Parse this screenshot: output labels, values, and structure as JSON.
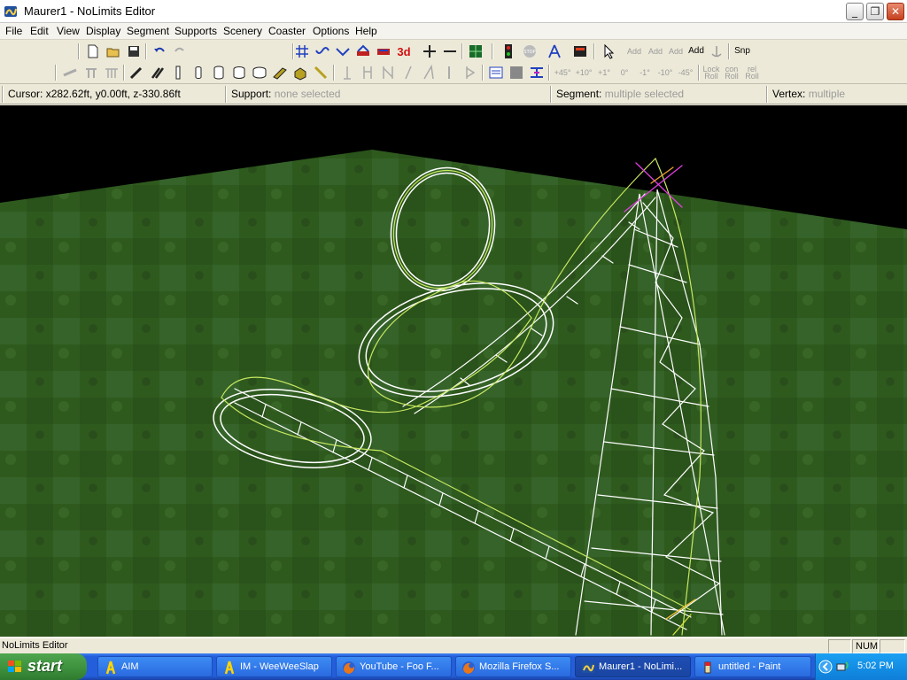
{
  "window": {
    "title": "Maurer1 - NoLimits Editor",
    "icon": "nolimits-app-icon",
    "controls": {
      "minimize": "_",
      "restore": "❐",
      "close": "✕"
    }
  },
  "menu": [
    "File",
    "Edit",
    "View",
    "Display",
    "Segment",
    "Supports",
    "Scenery",
    "Coaster",
    "Options",
    "Help"
  ],
  "toolbar": {
    "snap_label": "Snp",
    "add_labels": [
      "Add",
      "Add",
      "Add",
      "Add"
    ],
    "roll_labels": [
      "+45°",
      "+10°",
      "+1°",
      "0°",
      "-1°",
      "-10°",
      "-45°"
    ],
    "lock_roll": "Lock Roll",
    "con_roll": "con Roll",
    "rel_roll": "rel Roll",
    "view3d": "3d"
  },
  "infobar": {
    "cursor_label": "Cursor:",
    "cursor_value": "x282.62ft, y0.00ft, z-330.86ft",
    "support_label": "Support:",
    "support_value": "none selected",
    "segment_label": "Segment:",
    "segment_value": "multiple selected",
    "vertex_label": "Vertex:",
    "vertex_value": "multiple"
  },
  "colors": {
    "ground": "#2f5a1e",
    "sky": "#000000",
    "track_rail": "#ffffff",
    "spine": "#c8e860",
    "handle": "#e040e0",
    "handle_alt": "#f0a030"
  },
  "statusbar": {
    "text": "NoLimits Editor",
    "num": "NUM"
  },
  "taskbar": {
    "start": "start",
    "tasks": [
      {
        "label": "AIM",
        "icon": "aim-icon",
        "active": false
      },
      {
        "label": "IM - WeeWeeSlap",
        "icon": "aim-icon",
        "active": false
      },
      {
        "label": "YouTube - Foo F...",
        "icon": "firefox-icon",
        "active": false
      },
      {
        "label": "Mozilla Firefox S...",
        "icon": "firefox-icon",
        "active": false
      },
      {
        "label": "Maurer1 - NoLimi...",
        "icon": "nolimits-app-icon",
        "active": true
      },
      {
        "label": "untitled - Paint",
        "icon": "paint-icon",
        "active": false
      }
    ],
    "clock": "5:02 PM"
  }
}
